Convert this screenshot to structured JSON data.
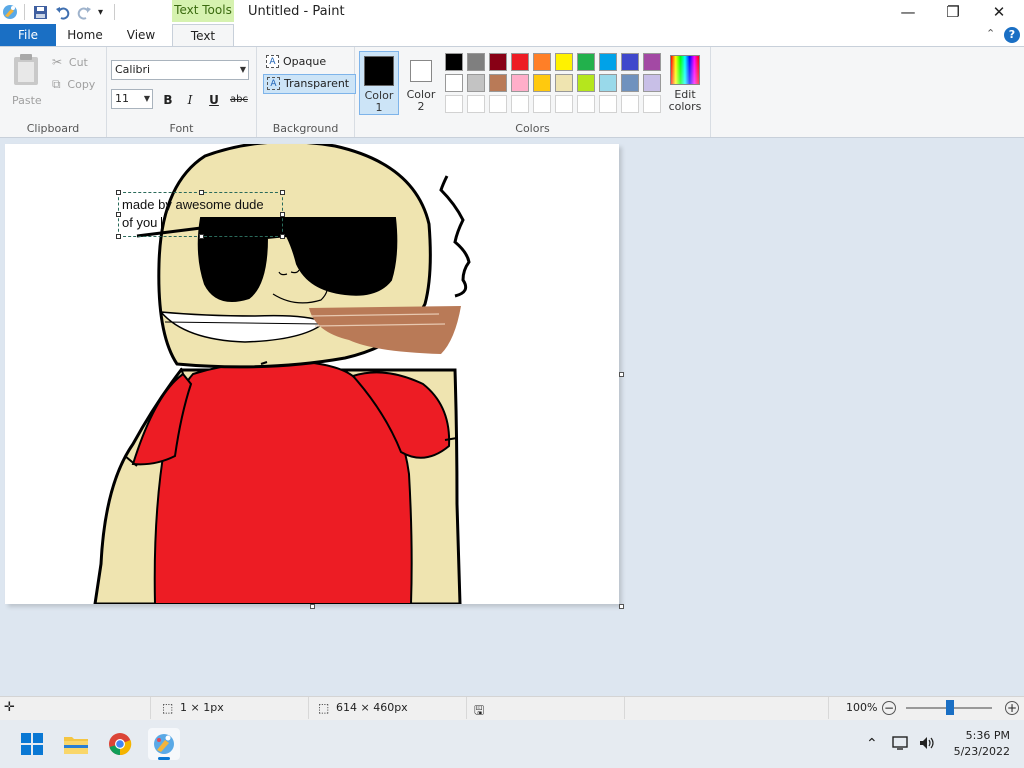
{
  "window": {
    "title": "Untitled - Paint",
    "context_tab_group": "Text Tools",
    "minimize_glyph": "—",
    "maximize_glyph": "❐",
    "close_glyph": "✕"
  },
  "tabs": {
    "file": "File",
    "home": "Home",
    "view": "View",
    "text": "Text"
  },
  "ribbon": {
    "clipboard": {
      "paste": "Paste",
      "cut": "Cut",
      "copy": "Copy",
      "label": "Clipboard"
    },
    "font": {
      "family": "Calibri",
      "size": "11",
      "bold": "B",
      "italic": "I",
      "underline": "U",
      "strike": "abc",
      "label": "Font"
    },
    "background": {
      "opaque": "Opaque",
      "transparent": "Transparent",
      "label": "Background"
    },
    "color1": {
      "line1": "Color",
      "line2": "1",
      "value": "#000000"
    },
    "color2": {
      "line1": "Color",
      "line2": "2",
      "value": "#ffffff"
    },
    "colors_label": "Colors",
    "edit_colors": {
      "line1": "Edit",
      "line2": "colors"
    },
    "palette_row1": [
      "#000000",
      "#7f7f7f",
      "#880015",
      "#ed1c24",
      "#ff7f27",
      "#fff200",
      "#22b14c",
      "#00a2e8",
      "#3f48cc",
      "#a349a4"
    ],
    "palette_row2": [
      "#ffffff",
      "#c3c3c3",
      "#b97a57",
      "#ffaec9",
      "#ffc90e",
      "#efe4b0",
      "#b5e61d",
      "#99d9ea",
      "#7092be",
      "#c8bfe7"
    ]
  },
  "canvas": {
    "text_line1": "made by awesome dude",
    "text_line2": "of you"
  },
  "status": {
    "selection_size": "1 × 1px",
    "image_size": "614 × 460px",
    "zoom": "100%"
  },
  "taskbar": {
    "time": "5:36 PM",
    "date": "5/23/2022"
  }
}
